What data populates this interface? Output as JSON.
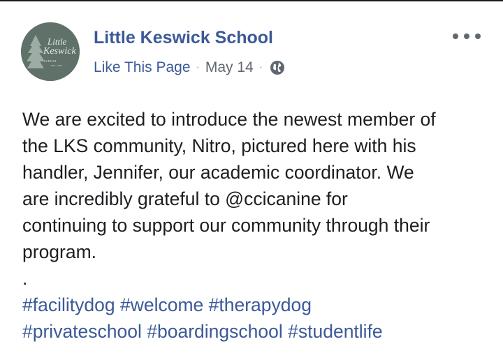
{
  "post": {
    "page_name": "Little Keswick School",
    "like_label": "Like This Page",
    "separator": "·",
    "date": "May 14",
    "audience_icon": "globe-icon",
    "more_icon": "more-options-icon",
    "avatar": {
      "line1": "Little",
      "line2": "Keswick",
      "line3": "SCHOOL",
      "line4": "EST. 1963"
    },
    "body_lines": [
      "We are excited to introduce the newest member of",
      "the LKS community, Nitro, pictured here with his",
      "handler, Jennifer, our academic coordinator. We",
      "are incredibly grateful to @ccicanine for",
      "continuing to support our community through their",
      "program.",
      "."
    ],
    "hashtags_line1": [
      "#facilitydog",
      "#welcome",
      "#therapydog"
    ],
    "hashtags_line2": [
      "#privateschool",
      "#boardingschool",
      "#studentlife"
    ]
  },
  "colors": {
    "link_blue": "#3b5998",
    "meta_gray": "#616770",
    "avatar_green": "#5f7168",
    "text": "#1c1e21"
  }
}
